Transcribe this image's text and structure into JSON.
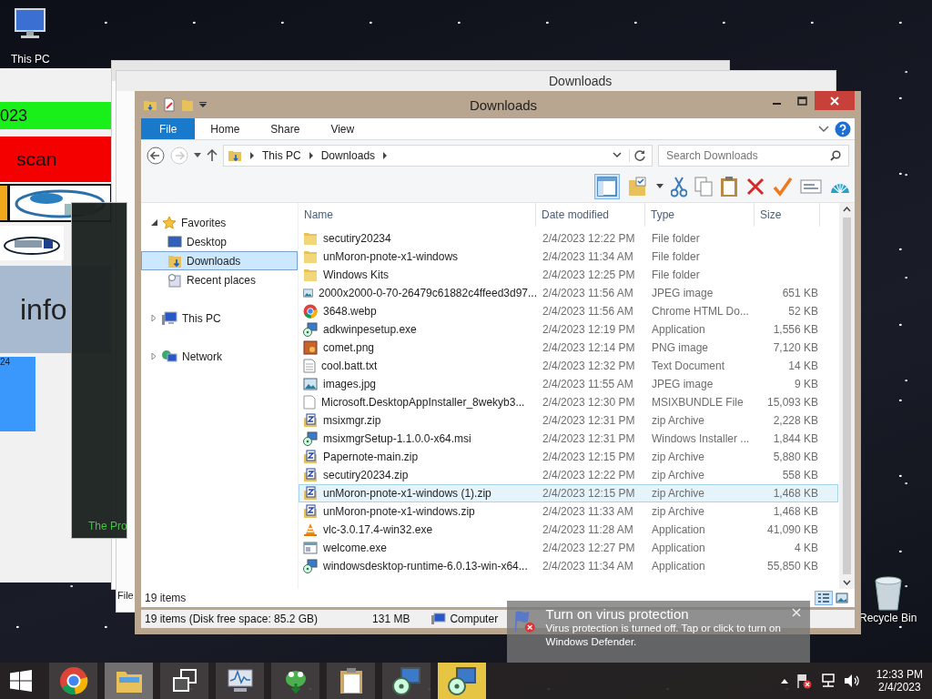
{
  "desktop_icons": [
    {
      "label": "This PC",
      "kind": "pc"
    },
    {
      "label": "Recycle Bin",
      "kind": "bin"
    }
  ],
  "back_app": {
    "date_bar": "023",
    "scan_button": "scan",
    "info_panel": "info",
    "tile_label": "24"
  },
  "dark_window": {
    "caption": "The Pro"
  },
  "back_explorer": {
    "title": "Downloads",
    "status": "File"
  },
  "window": {
    "title": "Downloads",
    "tabs": [
      {
        "label": "File",
        "selected": true
      },
      {
        "label": "Home",
        "selected": false
      },
      {
        "label": "Share",
        "selected": false
      },
      {
        "label": "View",
        "selected": false
      }
    ],
    "breadcrumbs": [
      "This PC",
      "Downloads"
    ],
    "search": {
      "placeholder": "Search Downloads"
    },
    "nav_tree": [
      {
        "label": "Favorites",
        "kind": "star",
        "expanded": true,
        "selected": false,
        "children": [
          {
            "label": "Desktop",
            "kind": "desktop",
            "selected": false
          },
          {
            "label": "Downloads",
            "kind": "downloads",
            "selected": true
          },
          {
            "label": "Recent places",
            "kind": "recent",
            "selected": false
          }
        ]
      },
      {
        "label": "This PC",
        "kind": "pc",
        "expanded": false,
        "selected": false
      },
      {
        "label": "Network",
        "kind": "network",
        "expanded": false,
        "selected": false
      }
    ],
    "columns": [
      "Name",
      "Date modified",
      "Type",
      "Size"
    ],
    "rows": [
      {
        "name": "secutiry20234",
        "date": "2/4/2023 12:22 PM",
        "type": "File folder",
        "size": "",
        "kind": "folder",
        "selected": false
      },
      {
        "name": "unMoron-pnote-x1-windows",
        "date": "2/4/2023 11:34 AM",
        "type": "File folder",
        "size": "",
        "kind": "folder",
        "selected": false
      },
      {
        "name": "Windows Kits",
        "date": "2/4/2023 12:25 PM",
        "type": "File folder",
        "size": "",
        "kind": "folder",
        "selected": false
      },
      {
        "name": "2000x2000-0-70-26479c61882c4ffeed3d97...",
        "date": "2/4/2023 11:56 AM",
        "type": "JPEG image",
        "size": "651 KB",
        "kind": "image",
        "selected": false
      },
      {
        "name": "3648.webp",
        "date": "2/4/2023 11:56 AM",
        "type": "Chrome HTML Do...",
        "size": "52 KB",
        "kind": "browser",
        "selected": false
      },
      {
        "name": "adkwinpesetup.exe",
        "date": "2/4/2023 12:19 PM",
        "type": "Application",
        "size": "1,556 KB",
        "kind": "setup",
        "selected": false
      },
      {
        "name": "comet.png",
        "date": "2/4/2023 12:14 PM",
        "type": "PNG image",
        "size": "7,120 KB",
        "kind": "png",
        "selected": false
      },
      {
        "name": "cool.batt.txt",
        "date": "2/4/2023 12:32 PM",
        "type": "Text Document",
        "size": "14 KB",
        "kind": "text",
        "selected": false
      },
      {
        "name": "images.jpg",
        "date": "2/4/2023 11:55 AM",
        "type": "JPEG image",
        "size": "9 KB",
        "kind": "image",
        "selected": false
      },
      {
        "name": "Microsoft.DesktopAppInstaller_8wekyb3...",
        "date": "2/4/2023 12:30 PM",
        "type": "MSIXBUNDLE File",
        "size": "15,093 KB",
        "kind": "blank",
        "selected": false
      },
      {
        "name": "msixmgr.zip",
        "date": "2/4/2023 12:31 PM",
        "type": "zip Archive",
        "size": "2,228 KB",
        "kind": "zip",
        "selected": false
      },
      {
        "name": "msixmgrSetup-1.1.0.0-x64.msi",
        "date": "2/4/2023 12:31 PM",
        "type": "Windows Installer ...",
        "size": "1,844 KB",
        "kind": "setup",
        "selected": false
      },
      {
        "name": "Papernote-main.zip",
        "date": "2/4/2023 12:15 PM",
        "type": "zip Archive",
        "size": "5,880 KB",
        "kind": "zip",
        "selected": false
      },
      {
        "name": "secutiry20234.zip",
        "date": "2/4/2023 12:22 PM",
        "type": "zip Archive",
        "size": "558 KB",
        "kind": "zip",
        "selected": false
      },
      {
        "name": "unMoron-pnote-x1-windows (1).zip",
        "date": "2/4/2023 12:15 PM",
        "type": "zip Archive",
        "size": "1,468 KB",
        "kind": "zip",
        "selected": true
      },
      {
        "name": "unMoron-pnote-x1-windows.zip",
        "date": "2/4/2023 11:33 AM",
        "type": "zip Archive",
        "size": "1,468 KB",
        "kind": "zip",
        "selected": false
      },
      {
        "name": "vlc-3.0.17.4-win32.exe",
        "date": "2/4/2023 11:28 AM",
        "type": "Application",
        "size": "41,090 KB",
        "kind": "cone",
        "selected": false
      },
      {
        "name": "welcome.exe",
        "date": "2/4/2023 12:27 PM",
        "type": "Application",
        "size": "4 KB",
        "kind": "exe",
        "selected": false
      },
      {
        "name": "windowsdesktop-runtime-6.0.13-win-x64...",
        "date": "2/4/2023 11:34 AM",
        "type": "Application",
        "size": "55,850 KB",
        "kind": "setup",
        "selected": false
      }
    ],
    "item_count": "19 items",
    "status_bar": {
      "summary": "19 items (Disk free space: 85.2 GB)",
      "size": "131 MB",
      "location": "Computer"
    }
  },
  "notification": {
    "title": "Turn on virus protection",
    "message": "Virus protection is turned off. Tap or click to turn on Windows Defender."
  },
  "taskbar": [
    {
      "kind": "start",
      "selected": false,
      "highlighted": false
    },
    {
      "kind": "browser",
      "selected": false,
      "highlighted": false
    },
    {
      "kind": "explorer",
      "selected": true,
      "highlighted": false
    },
    {
      "kind": "taskview",
      "selected": false,
      "highlighted": false
    },
    {
      "kind": "monitor",
      "selected": false,
      "highlighted": false
    },
    {
      "kind": "frog",
      "selected": false,
      "highlighted": false
    },
    {
      "kind": "clipboard",
      "selected": false,
      "highlighted": false
    },
    {
      "kind": "setup",
      "selected": false,
      "highlighted": false
    },
    {
      "kind": "setup",
      "selected": false,
      "highlighted": true
    }
  ],
  "clock": {
    "time": "12:33 PM",
    "date": "2/4/2023"
  }
}
